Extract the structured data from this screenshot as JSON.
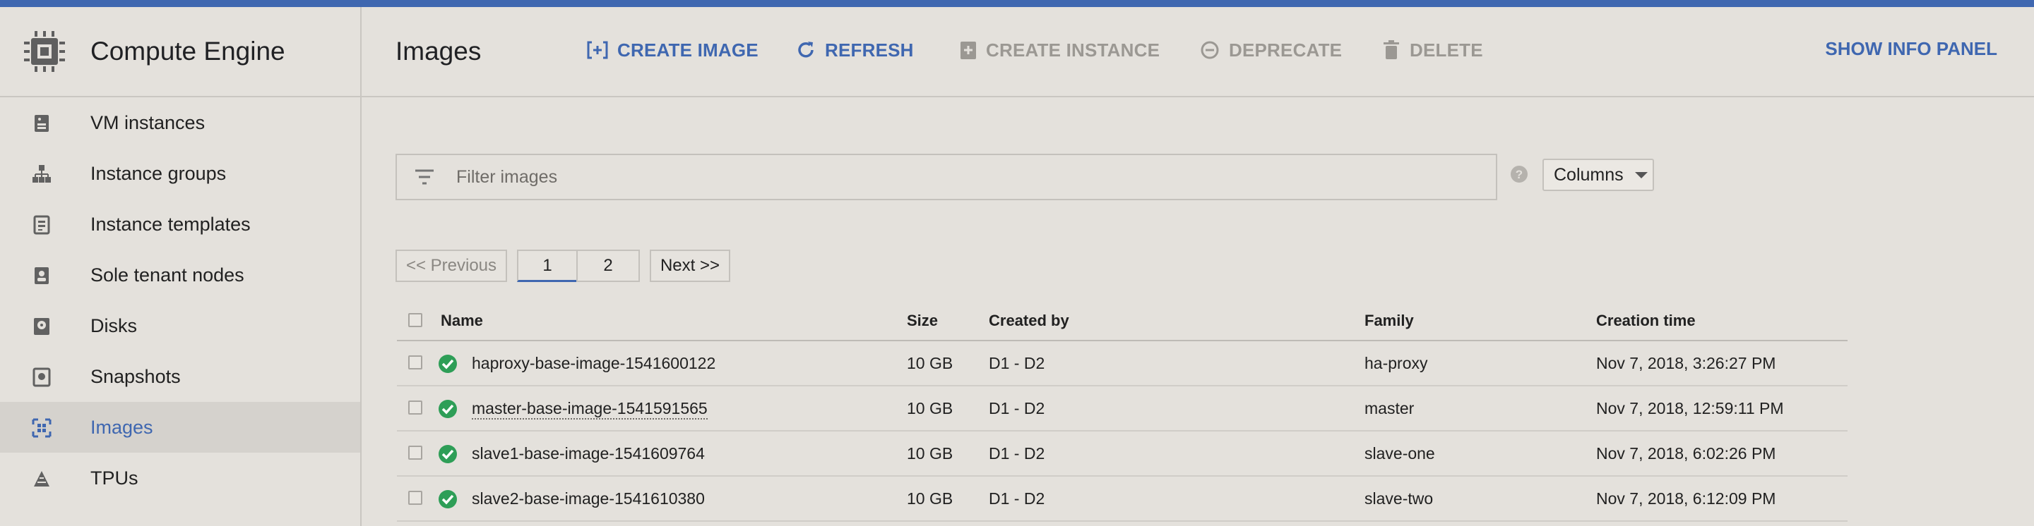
{
  "app": {
    "product_title": "Compute Engine",
    "accent_color": "#3f67b0",
    "product_icon": "chip-icon"
  },
  "sidebar": {
    "items": [
      {
        "label": "VM instances",
        "icon": "vm-instance-icon",
        "active": false
      },
      {
        "label": "Instance groups",
        "icon": "instance-groups-icon",
        "active": false
      },
      {
        "label": "Instance templates",
        "icon": "instance-template-icon",
        "active": false
      },
      {
        "label": "Sole tenant nodes",
        "icon": "sole-tenant-icon",
        "active": false
      },
      {
        "label": "Disks",
        "icon": "disk-icon",
        "active": false
      },
      {
        "label": "Snapshots",
        "icon": "snapshot-icon",
        "active": false
      },
      {
        "label": "Images",
        "icon": "images-icon",
        "active": true
      },
      {
        "label": "TPUs",
        "icon": "tpu-icon",
        "active": false
      }
    ]
  },
  "header": {
    "page_title": "Images",
    "actions": [
      {
        "label": "CREATE IMAGE",
        "icon": "create-image-icon",
        "enabled": true
      },
      {
        "label": "REFRESH",
        "icon": "refresh-icon",
        "enabled": true
      },
      {
        "label": "CREATE INSTANCE",
        "icon": "create-instance-icon",
        "enabled": false
      },
      {
        "label": "DEPRECATE",
        "icon": "deprecate-icon",
        "enabled": false
      },
      {
        "label": "DELETE",
        "icon": "delete-icon",
        "enabled": false
      }
    ],
    "show_info_panel": "SHOW INFO PANEL"
  },
  "filter": {
    "placeholder": "Filter images",
    "value": "",
    "columns_label": "Columns"
  },
  "pagination": {
    "previous": "<< Previous",
    "pages": [
      "1",
      "2"
    ],
    "current_page": "1",
    "next": "Next >>"
  },
  "table": {
    "columns": [
      "Name",
      "Size",
      "Created by",
      "Family",
      "Creation time"
    ],
    "rows": [
      {
        "status": "ready",
        "name": "haproxy-base-image-1541600122",
        "size": "10 GB",
        "created_by": "D1 - D2",
        "family": "ha-proxy",
        "time": "Nov 7, 2018, 3:26:27 PM"
      },
      {
        "status": "ready",
        "name": "master-base-image-1541591565",
        "size": "10 GB",
        "created_by": "D1 - D2",
        "family": "master",
        "time": "Nov 7, 2018, 12:59:11 PM"
      },
      {
        "status": "ready",
        "name": "slave1-base-image-1541609764",
        "size": "10 GB",
        "created_by": "D1 - D2",
        "family": "slave-one",
        "time": "Nov 7, 2018, 6:02:26 PM"
      },
      {
        "status": "ready",
        "name": "slave2-base-image-1541610380",
        "size": "10 GB",
        "created_by": "D1 - D2",
        "family": "slave-two",
        "time": "Nov 7, 2018, 6:12:09 PM"
      }
    ]
  },
  "colors": {
    "status_ok": "#2e9e57",
    "disabled_text": "#9b9893"
  }
}
